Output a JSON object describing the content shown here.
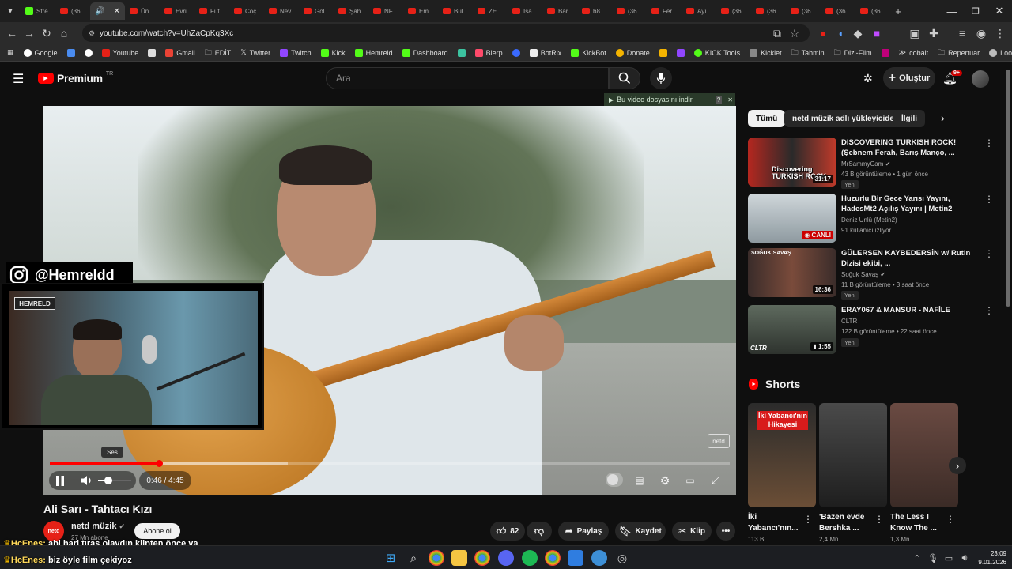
{
  "browser": {
    "tabs": [
      "Stre",
      "(36",
      "",
      "Ün",
      "Evri",
      "Fut",
      "Coç",
      "Nev",
      "Göl",
      "Şah",
      "NF",
      "Em",
      "Bül",
      "ZE",
      "Isa",
      "Bar",
      "b8",
      "(36",
      "Fer",
      "Ayı",
      "(36",
      "(36",
      "(36",
      "(36",
      "(36"
    ],
    "url": "youtube.com/watch?v=UhZaCpKq3Xc",
    "bookmarks": [
      "Google",
      "",
      "",
      "Youtube",
      "",
      "Gmail",
      "EDİT",
      "Twitter",
      "Twitch",
      "Kick",
      "Hemreld",
      "Dashboard",
      "",
      "Blerp",
      "",
      "BotRix",
      "KickBot",
      "Donate",
      "",
      "",
      "KICK Tools",
      "Kicklet",
      "Tahmin",
      "Dizi-Film",
      "",
      "cobalt",
      "Repertuar",
      "Looper"
    ]
  },
  "header": {
    "logo_text": "Premium",
    "logo_sup": "TR",
    "search_placeholder": "Ara",
    "create_label": "Oluştur",
    "notif_count": "9+"
  },
  "player": {
    "download_banner": "Bu video dosyasını indir",
    "watermark": "netd",
    "tooltip": "Ses",
    "time": "0:46 / 4:45",
    "progress": 0.161,
    "buffered": 0.35
  },
  "overlay": {
    "instagram": "@Hemreldd",
    "cam_logo": "HEMRELD"
  },
  "video": {
    "title": "Ali Sarı - Tahtacı Kızı",
    "channel": "netd müzik",
    "subs": "27 Mn abone",
    "subscribe": "Abone ol",
    "likes": "82",
    "share": "Paylaş",
    "save": "Kaydet",
    "clip": "Klip"
  },
  "chat": [
    {
      "name": "HcEnes:",
      "text": "abi bari tıraş olaydın klipten önce ya"
    },
    {
      "name": "HcEnes:",
      "text": "biz öyle film çekiyoz"
    }
  ],
  "sidebar": {
    "chips": [
      "Tümü",
      "netd müzik adlı yükleyiciden",
      "İlgili"
    ],
    "recs": [
      {
        "title": "DISCOVERING TURKISH ROCK! (Şebnem Ferah, Barış Manço, ...",
        "channel": "MrSammyCam",
        "meta": "43 B görüntüleme • 1 gün önce",
        "badge": "Yeni",
        "duration": "31:17",
        "thumb_text": "Discovering TURKISH ROCK"
      },
      {
        "title": "Huzurlu Bir Gece Yarısı Yayını, HadesMt2 Açılış Yayını | Metin2",
        "channel": "Deniz Ünlü (Metin2)",
        "meta": "91 kullanıcı izliyor",
        "badge": "",
        "duration": "CANLI",
        "thumb_text": ""
      },
      {
        "title": "GÜLERSEN KAYBEDERSİN w/ Rutin Dizisi ekibi, ...",
        "channel": "Soğuk Savaş",
        "meta": "11 B görüntüleme • 3 saat önce",
        "badge": "Yeni",
        "duration": "16:36",
        "thumb_text": "SOĞUK SAVAŞ"
      },
      {
        "title": "ERAY067 & MANSUR - NAFİLE",
        "channel": "CLTR",
        "meta": "122 B görüntüleme • 22 saat önce",
        "badge": "Yeni",
        "duration": "1:55",
        "thumb_text": "CLTR"
      }
    ],
    "shorts_label": "Shorts",
    "shorts": [
      {
        "title": "İki Yabancı'nın...",
        "views": "113 B",
        "thumb_text": "İki Yabancı'nın Hikayesi"
      },
      {
        "title": "'Bazen evde Bershka ...",
        "views": "2,4 Mn",
        "thumb_text": ""
      },
      {
        "title": "The Less I Know The ...",
        "views": "1,3 Mn",
        "thumb_text": ""
      }
    ]
  },
  "taskbar": {
    "time": "23:09",
    "date": "9.01.2026"
  }
}
